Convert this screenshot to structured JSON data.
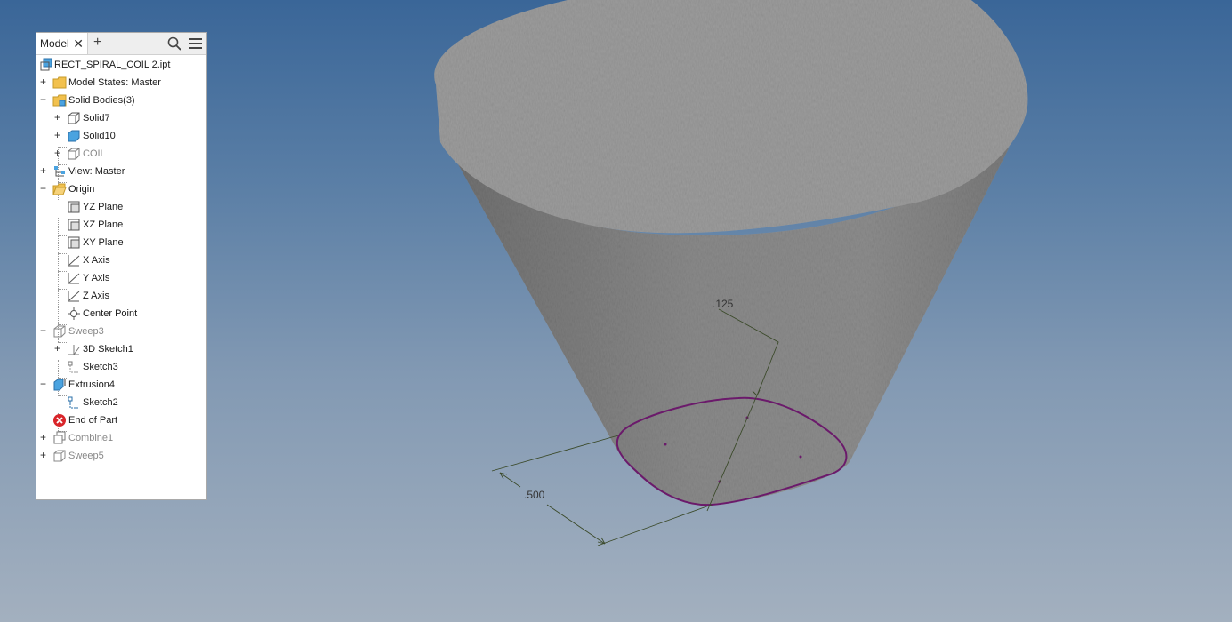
{
  "browser": {
    "tab_label": "Model",
    "tab_close_icon": "close-icon",
    "add_tab_icon": "plus-icon",
    "search_icon": "search-icon",
    "menu_icon": "hamburger-menu-icon"
  },
  "tree": {
    "root": "RECT_SPIRAL_COIL 2.ipt",
    "model_states": "Model States: Master",
    "solid_bodies": "Solid Bodies(3)",
    "solid7": "Solid7",
    "solid10": "Solid10",
    "coil": "COIL",
    "view": "View: Master",
    "origin": "Origin",
    "yz_plane": "YZ Plane",
    "xz_plane": "XZ Plane",
    "xy_plane": "XY Plane",
    "x_axis": "X Axis",
    "y_axis": "Y Axis",
    "z_axis": "Z Axis",
    "center_point": "Center Point",
    "sweep3": "Sweep3",
    "sketch3d1": "3D Sketch1",
    "sketch3": "Sketch3",
    "extrusion4": "Extrusion4",
    "sketch2": "Sketch2",
    "end_of_part": "End of Part",
    "combine1": "Combine1",
    "sweep5": "Sweep5"
  },
  "dimensions": {
    "dim_top": ".125",
    "dim_left": ".500"
  },
  "colors": {
    "background_top": "#3a6698",
    "background_bottom": "#a3b0bf",
    "body_fill": "#8c8c8c",
    "top_face": "#9a9a9a",
    "sketch_profile": "#6b1a6b",
    "dimension_line": "#3b4a2a",
    "end_of_part_icon": "#d9252a"
  }
}
